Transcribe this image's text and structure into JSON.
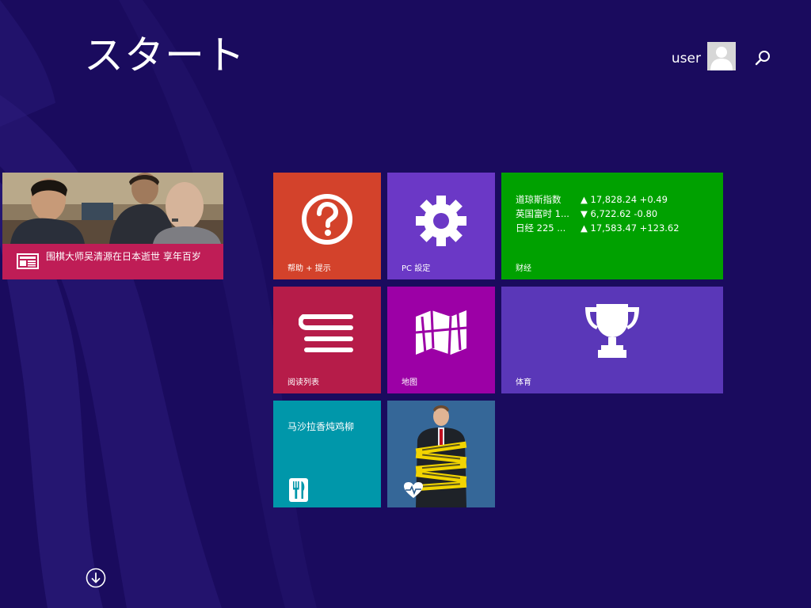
{
  "header": {
    "title": "スタート",
    "user_name": "user",
    "avatar_icon": "user-avatar-icon",
    "search_icon": "search-icon"
  },
  "tiles": {
    "news": {
      "caption": "围棋大师吴清源在日本逝世 享年百岁",
      "icon": "newspaper-icon",
      "color": "#bf1d56"
    },
    "help": {
      "label": "帮助 + 提示",
      "icon": "question-mark-icon",
      "color": "#d3422b"
    },
    "settings": {
      "label": "PC 設定",
      "icon": "gear-icon",
      "color": "#6b38c6"
    },
    "finance": {
      "label": "财经",
      "color": "#00a100",
      "rows": [
        {
          "name": "道琼斯指数",
          "value": "▲ 17,828.24 +0.49"
        },
        {
          "name": "英国富时 1...",
          "value": "▼ 6,722.62 -0.80"
        },
        {
          "name": "日经 225 ...",
          "value": "▲ 17,583.47 +123.62"
        }
      ]
    },
    "reading_list": {
      "label": "阅读列表",
      "icon": "reading-list-icon",
      "color": "#b61c49"
    },
    "maps": {
      "label": "地图",
      "icon": "map-icon",
      "color": "#9c00a6"
    },
    "sports": {
      "label": "体育",
      "icon": "trophy-icon",
      "color": "#5a37b8"
    },
    "food": {
      "title": "马沙拉香炖鸡柳",
      "icon": "fork-knife-icon",
      "color": "#0097aa"
    },
    "health": {
      "icon": "heart-pulse-icon",
      "color": "#2a5a8a"
    }
  },
  "footer": {
    "apps_icon": "arrow-down-circle-icon"
  }
}
